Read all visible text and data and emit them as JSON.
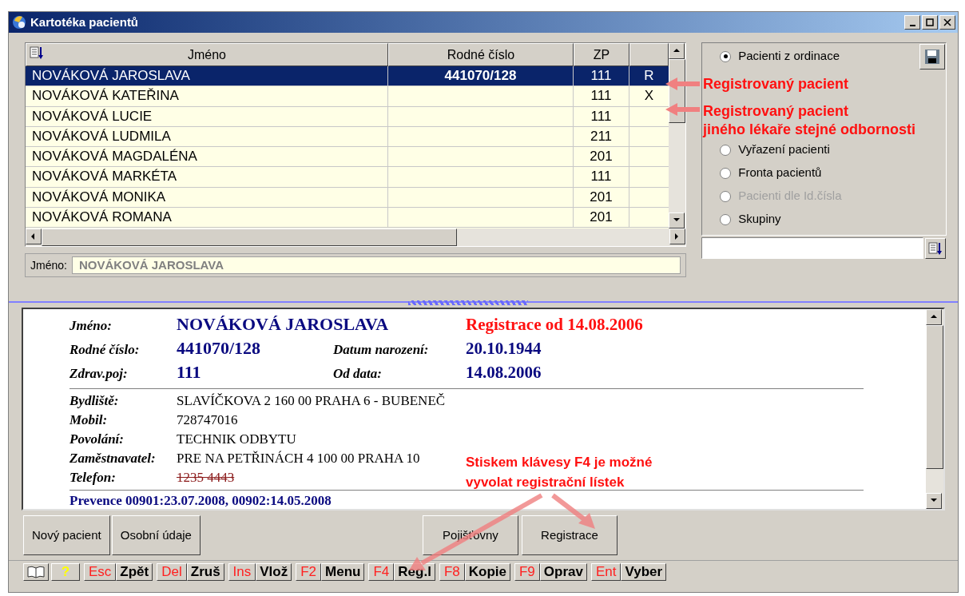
{
  "window": {
    "title": "Kartotéka pacientů"
  },
  "list": {
    "columns": [
      "Jméno",
      "Rodné číslo",
      "ZP"
    ],
    "rows": [
      {
        "name": "NOVÁKOVÁ JAROSLAVA",
        "birth_number": "441070/128",
        "zp": "111",
        "flag": "R",
        "selected": true
      },
      {
        "name": "NOVÁKOVÁ KATEŘINA",
        "zp": "111",
        "flag": "X",
        "selected": false
      },
      {
        "name": "NOVÁKOVÁ LUCIE",
        "zp": "111",
        "selected": false
      },
      {
        "name": "NOVÁKOVÁ LUDMILA",
        "zp": "211",
        "selected": false
      },
      {
        "name": "NOVÁKOVÁ MAGDALÉNA",
        "zp": "201",
        "selected": false
      },
      {
        "name": "NOVÁKOVÁ MARKÉTA",
        "zp": "111",
        "selected": false
      },
      {
        "name": "NOVÁKOVÁ MONIKA",
        "zp": "201",
        "selected": false
      },
      {
        "name": "NOVÁKOVÁ ROMANA",
        "zp": "201",
        "selected": false
      }
    ],
    "name_field": {
      "label": "Jméno:",
      "value": "NOVÁKOVÁ JAROSLAVA"
    }
  },
  "filter": {
    "options": [
      {
        "label": "Pacienti z ordinace",
        "selected": true,
        "disabled": false
      },
      {
        "label": "Vyřazení pacienti",
        "selected": false,
        "disabled": false
      },
      {
        "label": "Fronta pacientů",
        "selected": false,
        "disabled": false
      },
      {
        "label": "Pacienti dle Id.čísla",
        "selected": false,
        "disabled": true
      },
      {
        "label": "Skupiny",
        "selected": false,
        "disabled": false
      }
    ]
  },
  "detail": {
    "name_label": "Jméno:",
    "name": "NOVÁKOVÁ JAROSLAVA",
    "registration": "Registrace od 14.08.2006",
    "summary": [
      {
        "label": "Rodné číslo:",
        "value": "441070/128",
        "label2": "Datum narození:",
        "value2": "20.10.1944"
      },
      {
        "label": "Zdrav.poj:",
        "value": "111",
        "label2": "Od data:",
        "value2": "14.08.2006"
      }
    ],
    "contacts": [
      {
        "label": "Bydliště:",
        "value": "SLAVÍČKOVA 2  160 00 PRAHA 6 - BUBENEČ",
        "struck": false
      },
      {
        "label": "Mobil:",
        "value": "728747016",
        "struck": false
      },
      {
        "label": "Povolání:",
        "value": "TECHNIK ODBYTU",
        "struck": false
      },
      {
        "label": "Zaměstnavatel:",
        "value": "PRE NA PETŘINÁCH 4  100 00 PRAHA 10",
        "struck": false
      },
      {
        "label": "Telefon:",
        "value": "1235 4443",
        "struck": true
      }
    ],
    "prevention": "Prevence 00901:23.07.2008, 00902:14.05.2008"
  },
  "buttons_left": [
    "Nový pacient",
    "Osobní údaje"
  ],
  "buttons_right": [
    "Pojišťovny",
    "Registrace"
  ],
  "status_bar": {
    "help": "?",
    "keys": [
      {
        "key": "Esc",
        "label": "Zpět"
      },
      {
        "key": "Del",
        "label": "Zruš"
      },
      {
        "key": "Ins",
        "label": "Vlož"
      },
      {
        "key": "F2",
        "label": "Menu"
      },
      {
        "key": "F4",
        "label": "Reg.l"
      },
      {
        "key": "F8",
        "label": "Kopie"
      },
      {
        "key": "F9",
        "label": "Oprav"
      },
      {
        "key": "Ent",
        "label": "Vyber"
      }
    ]
  },
  "annotations": [
    {
      "lines": [
        "Registrovaný pacient"
      ]
    },
    {
      "lines": [
        "Registrovaný pacient",
        "jiného lékaře stejné odbornosti"
      ]
    },
    {
      "lines": [
        "Stiskem klávesy F4 je možné",
        "vyvolat registrační lístek"
      ]
    }
  ]
}
